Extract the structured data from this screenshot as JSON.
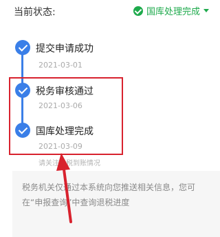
{
  "status": {
    "label": "当前状态:",
    "value": "国库处理完成",
    "check_icon": "check-circle-icon",
    "dropdown_icon": "caret-down-icon",
    "color": "#1eaa4c"
  },
  "timeline": {
    "color": "#3a7fe8",
    "steps": [
      {
        "title": "提交申请成功",
        "date": "2021-03-01"
      },
      {
        "title": "税务审核通过",
        "date": "2021-03-06"
      },
      {
        "title": "国库处理完成",
        "date": "2021-03-09"
      }
    ]
  },
  "faded_hint": "请关注退税到账情况",
  "note": {
    "text": "税务机关仅通过本系统向您推送相关信息，您可在“申报查询”中查询退税进度"
  },
  "annotation": {
    "color": "#d8222e"
  }
}
